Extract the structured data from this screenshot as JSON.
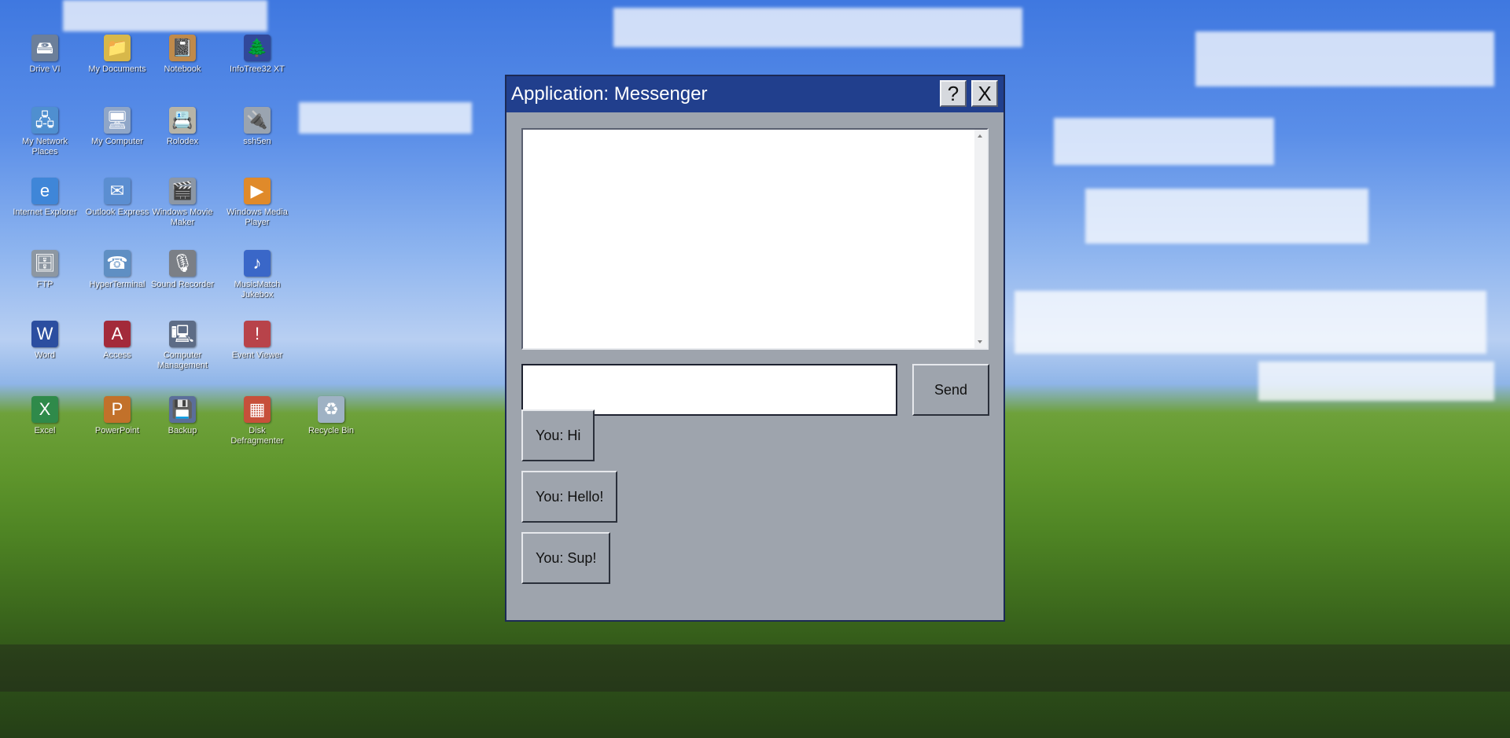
{
  "desktop": {
    "icons": [
      {
        "label": "Drive VI",
        "icon": "drive-icon",
        "glyph": "🖴",
        "color": "#6c7f9a"
      },
      {
        "label": "My Documents",
        "icon": "documents-folder-icon",
        "glyph": "📁",
        "color": "#d8b84a"
      },
      {
        "label": "Notebook",
        "icon": "notebook-icon",
        "glyph": "📓",
        "color": "#c08a4a"
      },
      {
        "label": "InfoTree32 XT",
        "icon": "infotree-icon",
        "glyph": "🌲",
        "color": "#31489a"
      },
      {
        "label": "My Network Places",
        "icon": "network-places-icon",
        "glyph": "🖧",
        "color": "#4f8fd0"
      },
      {
        "label": "My Computer",
        "icon": "computer-icon",
        "glyph": "🖥",
        "color": "#8fa6c8"
      },
      {
        "label": "Rolodex",
        "icon": "rolodex-icon",
        "glyph": "📇",
        "color": "#b7b4a7"
      },
      {
        "label": "ssh5en",
        "icon": "ssh-icon",
        "glyph": "🔌",
        "color": "#9aa4b0"
      },
      {
        "label": "Internet Explorer",
        "icon": "internet-explorer-icon",
        "glyph": "e",
        "color": "#3f86d8"
      },
      {
        "label": "Outlook Express",
        "icon": "outlook-express-icon",
        "glyph": "✉",
        "color": "#5b8ed1"
      },
      {
        "label": "Windows Movie Maker",
        "icon": "movie-maker-icon",
        "glyph": "🎬",
        "color": "#8c97a5"
      },
      {
        "label": "Windows Media Player",
        "icon": "media-player-icon",
        "glyph": "▶",
        "color": "#e08a2a"
      },
      {
        "label": "FTP",
        "icon": "ftp-icon",
        "glyph": "🗄",
        "color": "#8d97a2"
      },
      {
        "label": "HyperTerminal",
        "icon": "hyperterminal-icon",
        "glyph": "☎",
        "color": "#5f8fc3"
      },
      {
        "label": "Sound Recorder",
        "icon": "sound-recorder-icon",
        "glyph": "🎙",
        "color": "#7b7f86"
      },
      {
        "label": "MusicMatch Jukebox",
        "icon": "jukebox-icon",
        "glyph": "♪",
        "color": "#3a67c8"
      },
      {
        "label": "Word",
        "icon": "word-icon",
        "glyph": "W",
        "color": "#2b4ea0"
      },
      {
        "label": "Access",
        "icon": "access-icon",
        "glyph": "A",
        "color": "#a32a3a"
      },
      {
        "label": "Computer Management",
        "icon": "computer-management-icon",
        "glyph": "🖳",
        "color": "#5d6c86"
      },
      {
        "label": "Event Viewer",
        "icon": "event-viewer-icon",
        "glyph": "!",
        "color": "#b8434a"
      },
      {
        "label": "Excel",
        "icon": "excel-icon",
        "glyph": "X",
        "color": "#2f8a4a"
      },
      {
        "label": "PowerPoint",
        "icon": "powerpoint-icon",
        "glyph": "P",
        "color": "#c2712a"
      },
      {
        "label": "Backup",
        "icon": "backup-icon",
        "glyph": "💾",
        "color": "#5b6e9a"
      },
      {
        "label": "Disk Defragmenter",
        "icon": "disk-defragmenter-icon",
        "glyph": "▦",
        "color": "#c7503a"
      },
      {
        "label": "Recycle Bin",
        "icon": "recycle-bin-icon",
        "glyph": "♻",
        "color": "#9fb2c4"
      }
    ]
  },
  "window": {
    "title": "Application: Messenger",
    "help_label": "?",
    "close_label": "X",
    "chat_log_text": "",
    "message_input_value": "",
    "send_label": "Send",
    "messages": [
      {
        "label": "You: Hi"
      },
      {
        "label": "You: Hello!"
      },
      {
        "label": "You: Sup!"
      }
    ]
  },
  "colors": {
    "titlebar": "#213f8d",
    "window_body": "#9ea4ad",
    "title_text": "#ffffff"
  }
}
